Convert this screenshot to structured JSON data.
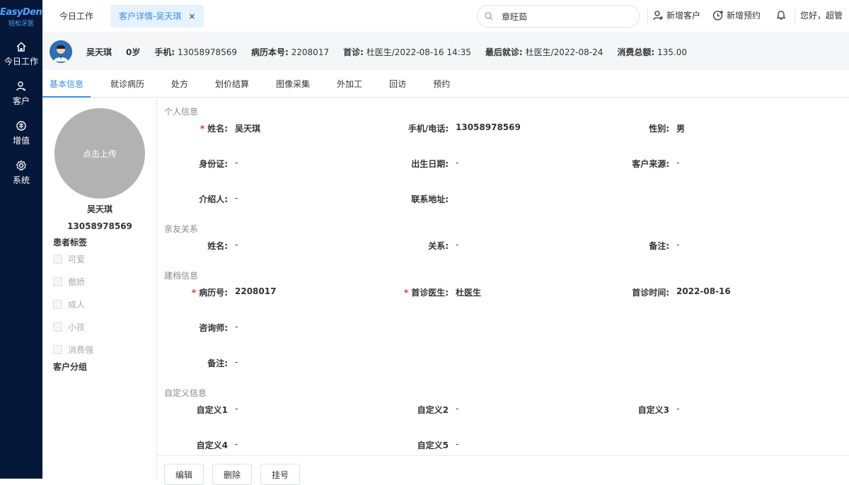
{
  "brand": {
    "logo": "EasyDent",
    "subtitle": "轻松牙医"
  },
  "sidebar": {
    "items": [
      {
        "label": "今日工作",
        "icon": "home-icon"
      },
      {
        "label": "客户",
        "icon": "user-icon"
      },
      {
        "label": "增值",
        "icon": "value-icon"
      },
      {
        "label": "系统",
        "icon": "gear-icon"
      }
    ]
  },
  "topbar": {
    "tabs": [
      {
        "label": "今日工作"
      },
      {
        "label": "客户详情-吴天琪",
        "close": "×"
      }
    ],
    "search": {
      "value": "章旺茹"
    },
    "new_customer": "新增客户",
    "new_appointment": "新增预约",
    "greeting": "您好，超管"
  },
  "patient": {
    "name": "吴天琪",
    "age": "0岁",
    "phone_label": "手机:",
    "phone": "13058978569",
    "record_label": "病历本号:",
    "record": "2208017",
    "first_visit_label": "首诊:",
    "first_visit": "杜医生/2022-08-16 14:35",
    "last_visit_label": "最后就诊:",
    "last_visit": "杜医生/2022-08-24",
    "total_label": "消费总额:",
    "total": "135.00"
  },
  "subtabs": [
    "基本信息",
    "就诊病历",
    "处方",
    "划价结算",
    "图像采集",
    "外加工",
    "回访",
    "预约"
  ],
  "profile": {
    "upload": "点击上传",
    "name": "吴天琪",
    "phone": "13058978569",
    "tags_title": "患者标签",
    "tags": [
      "可爱",
      "傲娇",
      "成人",
      "小孩",
      "消费强"
    ],
    "group_title": "客户分组"
  },
  "form": {
    "personal_title": "个人信息",
    "name_label": "姓名:",
    "name": "吴天琪",
    "phone_label": "手机/电话:",
    "phone": "13058978569",
    "gender_label": "性别:",
    "gender": "男",
    "id_label": "身份证:",
    "id": "-",
    "birth_label": "出生日期:",
    "birth": "-",
    "source_label": "客户来源:",
    "source": "-",
    "referrer_label": "介绍人:",
    "referrer": "-",
    "address_label": "联系地址:",
    "address": "",
    "relatives_title": "亲友关系",
    "rel_name_label": "姓名:",
    "rel_name": "-",
    "relation_label": "关系:",
    "relation": "-",
    "rel_note_label": "备注:",
    "rel_note": "-",
    "filing_title": "建档信息",
    "record_label": "病历号:",
    "record": "2208017",
    "first_doctor_label": "首诊医生:",
    "first_doctor": "杜医生",
    "first_time_label": "首诊时间:",
    "first_time": "2022-08-16",
    "consultant_label": "咨询师:",
    "consultant": "-",
    "note_label": "备注:",
    "note": "-",
    "custom_title": "自定义信息",
    "custom1_label": "自定义1",
    "custom1": "-",
    "custom2_label": "自定义2",
    "custom2": "-",
    "custom3_label": "自定义3",
    "custom3": "-",
    "custom4_label": "自定义4",
    "custom4": "-",
    "custom5_label": "自定义5",
    "custom5": "-"
  },
  "buttons": {
    "edit": "编辑",
    "delete": "删除",
    "register": "挂号"
  }
}
